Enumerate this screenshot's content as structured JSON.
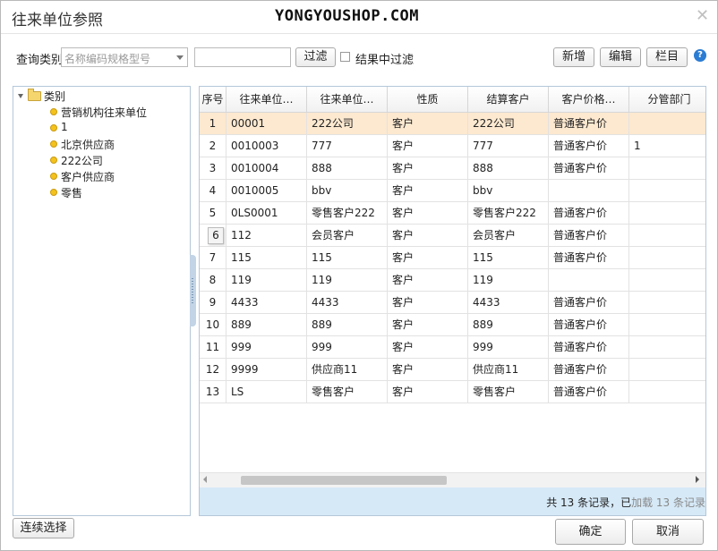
{
  "window": {
    "title": "往来单位参照",
    "watermark": "YONGYOUSHOP.COM"
  },
  "query": {
    "category_label": "查询类别",
    "category_placeholder": "名称编码规格型号",
    "filter_value": "",
    "filter_button": "过滤",
    "filter_in_results_label": "结果中过滤",
    "filter_in_results_checked": false
  },
  "toolbar": {
    "new_label": "新增",
    "edit_label": "编辑",
    "columns_label": "栏目",
    "help_glyph": "?"
  },
  "tree": {
    "root": "类别",
    "children": [
      "营销机构往来单位",
      "1",
      "北京供应商",
      "222公司",
      "客户供应商",
      "零售"
    ]
  },
  "grid": {
    "columns": [
      "序号",
      "往来单位…",
      "往来单位…",
      "性质",
      "结算客户",
      "客户价格…",
      "分管部门"
    ],
    "rows": [
      [
        "1",
        "00001",
        "222公司",
        "客户",
        "222公司",
        "普通客户价",
        ""
      ],
      [
        "2",
        "0010003",
        "777",
        "客户",
        "777",
        "普通客户价",
        "1"
      ],
      [
        "3",
        "0010004",
        "888",
        "客户",
        "888",
        "普通客户价",
        ""
      ],
      [
        "4",
        "0010005",
        "bbv",
        "客户",
        "bbv",
        "",
        ""
      ],
      [
        "5",
        "0LS0001",
        "零售客户222",
        "客户",
        "零售客户222",
        "普通客户价",
        ""
      ],
      [
        "6",
        "112",
        "会员客户",
        "客户",
        "会员客户",
        "普通客户价",
        ""
      ],
      [
        "7",
        "115",
        "115",
        "客户",
        "115",
        "普通客户价",
        ""
      ],
      [
        "8",
        "119",
        "119",
        "客户",
        "119",
        "",
        ""
      ],
      [
        "9",
        "4433",
        "4433",
        "客户",
        "4433",
        "普通客户价",
        ""
      ],
      [
        "10",
        "889",
        "889",
        "客户",
        "889",
        "普通客户价",
        ""
      ],
      [
        "11",
        "999",
        "999",
        "客户",
        "999",
        "普通客户价",
        ""
      ],
      [
        "12",
        "9999",
        "供应商11",
        "客户",
        "供应商11",
        "普通客户价",
        ""
      ],
      [
        "13",
        "LS",
        "零售客户",
        "客户",
        "零售客户",
        "普通客户价",
        ""
      ]
    ],
    "selected_row": 1,
    "status_total": "共 13 条记录，已",
    "status_loaded": "加载 13 条记录"
  },
  "footer": {
    "continuous_select": "连续选择",
    "ok": "确定",
    "cancel": "取消"
  },
  "icons": {
    "close": "close-icon",
    "help": "help-icon",
    "tree_caret": "caret-down-icon",
    "folder": "folder-icon",
    "node": "node-dot-icon"
  },
  "colors": {
    "selected_row": "#fde9d0",
    "status_bar": "#d6e9f7",
    "help": "#2b7cd3"
  }
}
